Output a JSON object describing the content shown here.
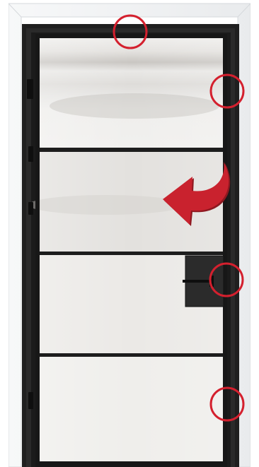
{
  "colors": {
    "background": "#ffffff",
    "casing": "#f4f5f6",
    "casing_shadow": "#d9dcdf",
    "frame": "#1f1f1f",
    "glass_light": "#f2f1ef",
    "glass_mid": "#dcdad7",
    "glass_dark": "#bfbcb8",
    "marker_red": "#d4202e",
    "arrow_red": "#c9222e",
    "arrow_shadow": "#8e1820"
  },
  "icons": {
    "markers": "circle-outline",
    "direction": "curved-arrow-left",
    "hardware": "pull-handle",
    "hinge": "hinge"
  },
  "markers": [
    {
      "name": "top-frame-marker"
    },
    {
      "name": "upper-latch-marker"
    },
    {
      "name": "handle-latch-marker"
    },
    {
      "name": "lower-latch-marker"
    }
  ],
  "hinges": [
    {
      "name": "hinge-top"
    },
    {
      "name": "hinge-middle"
    },
    {
      "name": "hinge-lower"
    },
    {
      "name": "hinge-bottom"
    }
  ]
}
